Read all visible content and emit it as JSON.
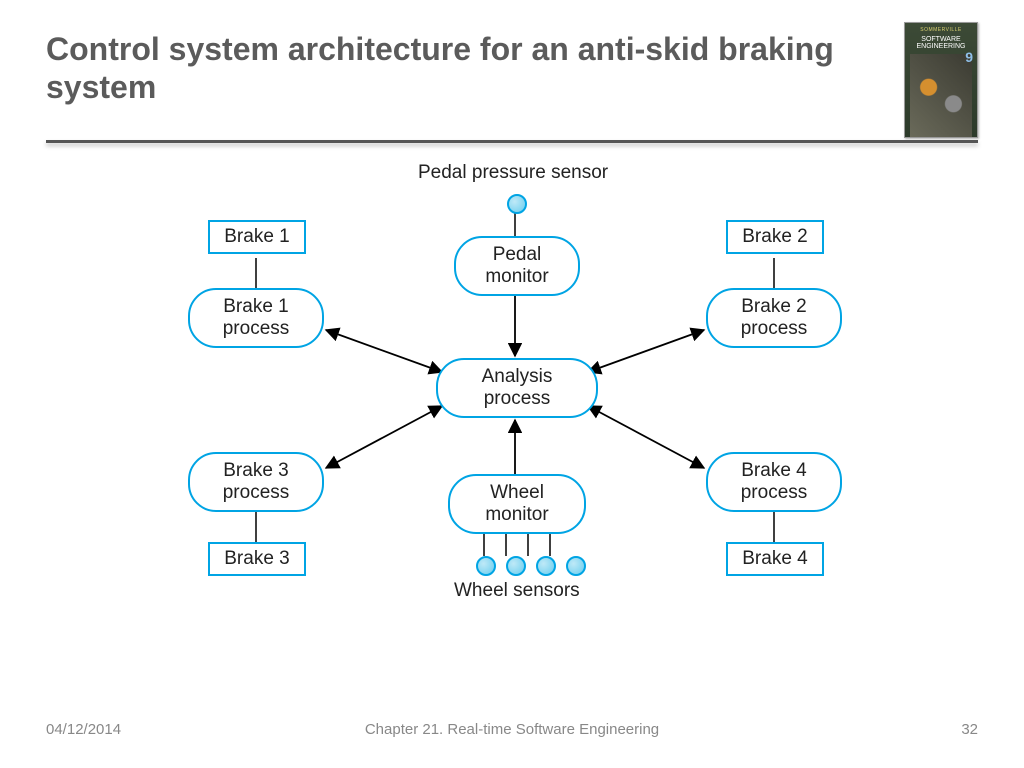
{
  "title": "Control system architecture for an anti-skid braking system",
  "book": {
    "top": "SOMMERVILLE",
    "title": "SOFTWARE ENGINEERING",
    "edition": "9"
  },
  "labels": {
    "pedal_pressure_sensor": "Pedal pressure sensor",
    "wheel_sensors": "Wheel sensors"
  },
  "nodes": {
    "brake1": "Brake 1",
    "brake2": "Brake 2",
    "brake3": "Brake 3",
    "brake4": "Brake 4",
    "brake1_process": "Brake 1\nprocess",
    "brake2_process": "Brake 2\nprocess",
    "brake3_process": "Brake 3\nprocess",
    "brake4_process": "Brake 4\nprocess",
    "pedal_monitor": "Pedal\nmonitor",
    "analysis_process": "Analysis\nprocess",
    "wheel_monitor": "Wheel\nmonitor"
  },
  "footer": {
    "date": "04/12/2014",
    "chapter": "Chapter 21. Real-time Software Engineering",
    "page": "32"
  }
}
